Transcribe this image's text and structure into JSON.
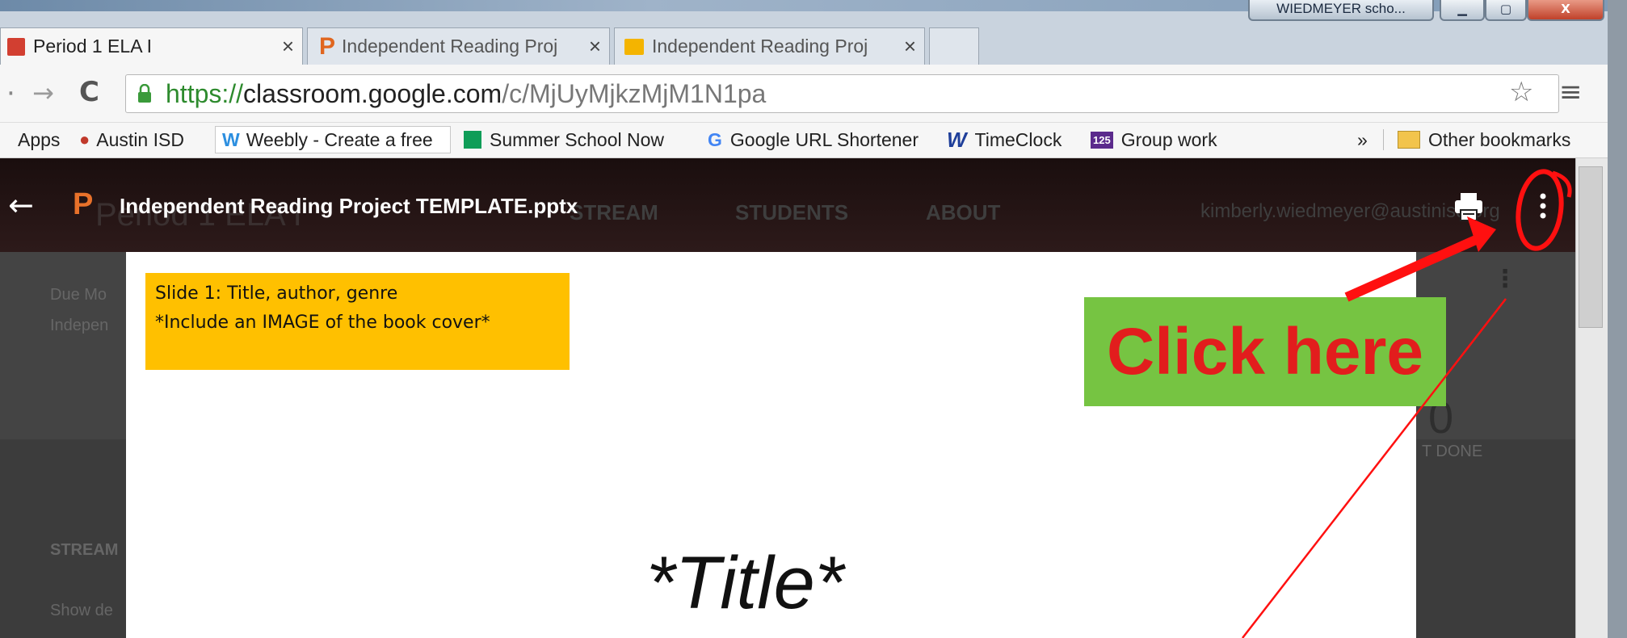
{
  "window": {
    "title_chip": "WIEDMEYER scho..."
  },
  "tabs": [
    {
      "label": "Period 1 ELA I",
      "close": "×"
    },
    {
      "label": "Independent Reading Proj",
      "close": "×"
    },
    {
      "label": "Independent Reading Proj",
      "close": "×"
    }
  ],
  "address": {
    "scheme": "https://",
    "host": "classroom.google.com",
    "path": "/c/MjUyMjkzMjM1N1pa"
  },
  "bookmarks": {
    "items": [
      {
        "label": "Apps"
      },
      {
        "label": "Austin ISD"
      },
      {
        "label": "Weebly - Create a free"
      },
      {
        "label": "Summer School Now"
      },
      {
        "label": "Google URL Shortener"
      },
      {
        "label": "TimeClock"
      },
      {
        "label": "Group work"
      }
    ],
    "overflow": "»",
    "other": "Other bookmarks"
  },
  "viewer": {
    "filename": "Independent Reading Project TEMPLATE.pptx",
    "back": "←"
  },
  "background_page": {
    "class_name": "Period 1 ELA I",
    "nav": [
      "STREAM",
      "STUDENTS",
      "ABOUT"
    ],
    "user_email": "kimberly.wiedmeyer@austinisd.org",
    "due_text": "Due Mo",
    "assignment_text": "Indepen",
    "count": "0",
    "not_done": "T DONE",
    "stream_label": "STREAM",
    "show_text": "Show de"
  },
  "slide": {
    "note_line1": "Slide 1: Title, author, genre",
    "note_line2": "*Include an IMAGE of the book cover*",
    "title": "*Title*"
  },
  "annotation": {
    "callout": "Click here",
    "arrow_color": "#ff0000"
  },
  "colors": {
    "note_bg": "#ffc000",
    "callout_bg": "#76c442",
    "callout_text": "#e21d1d"
  }
}
